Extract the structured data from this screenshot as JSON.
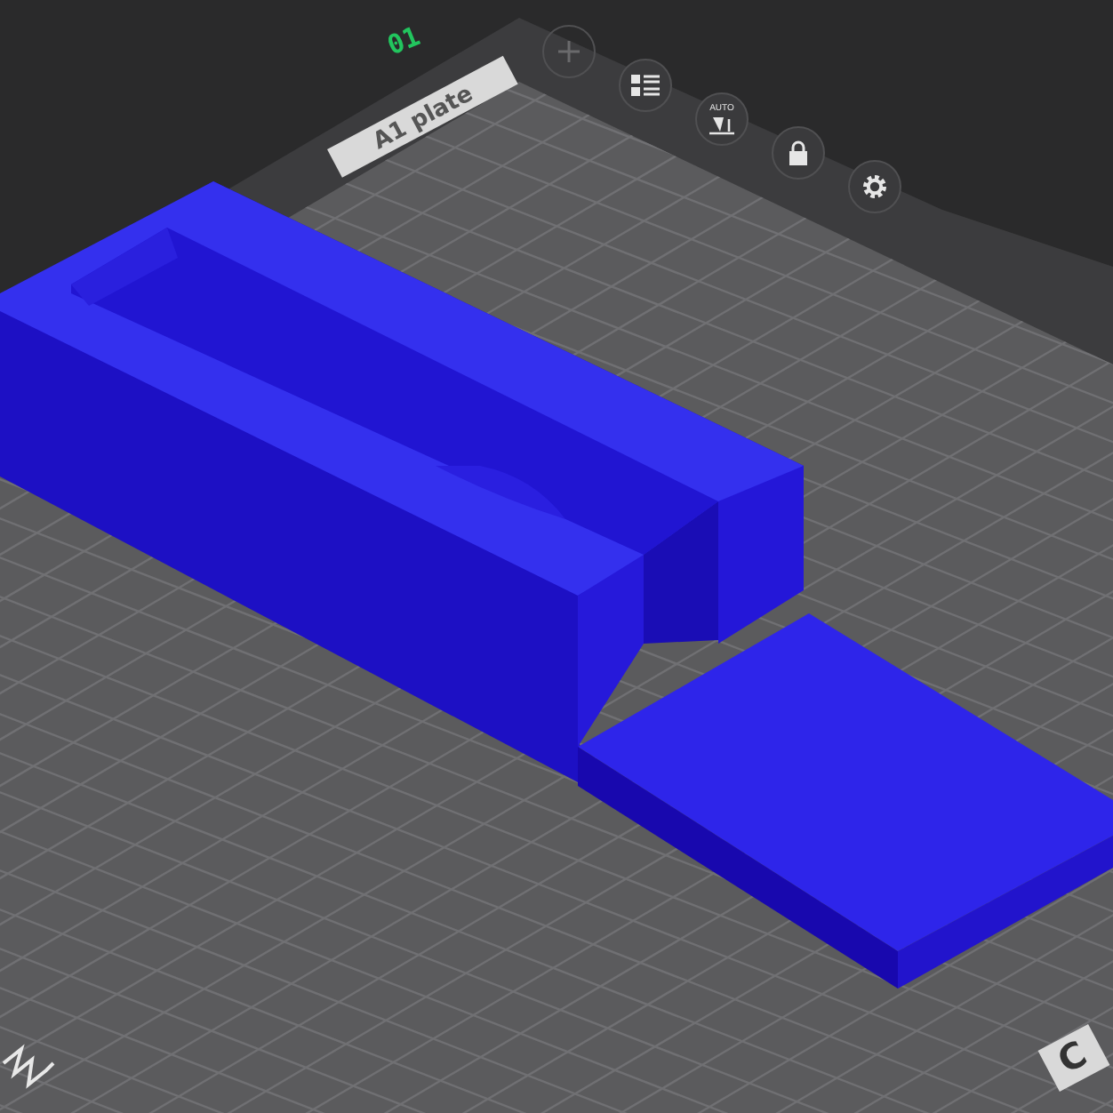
{
  "plate": {
    "number": "01",
    "label": "A1 plate"
  },
  "toolbar": [
    {
      "kind": "add",
      "disabled": true
    },
    {
      "kind": "arrange",
      "disabled": false
    },
    {
      "kind": "orient",
      "disabled": false,
      "label": "AUTO"
    },
    {
      "kind": "lock",
      "disabled": false
    },
    {
      "kind": "settings",
      "disabled": false
    }
  ],
  "corner_label": "C"
}
